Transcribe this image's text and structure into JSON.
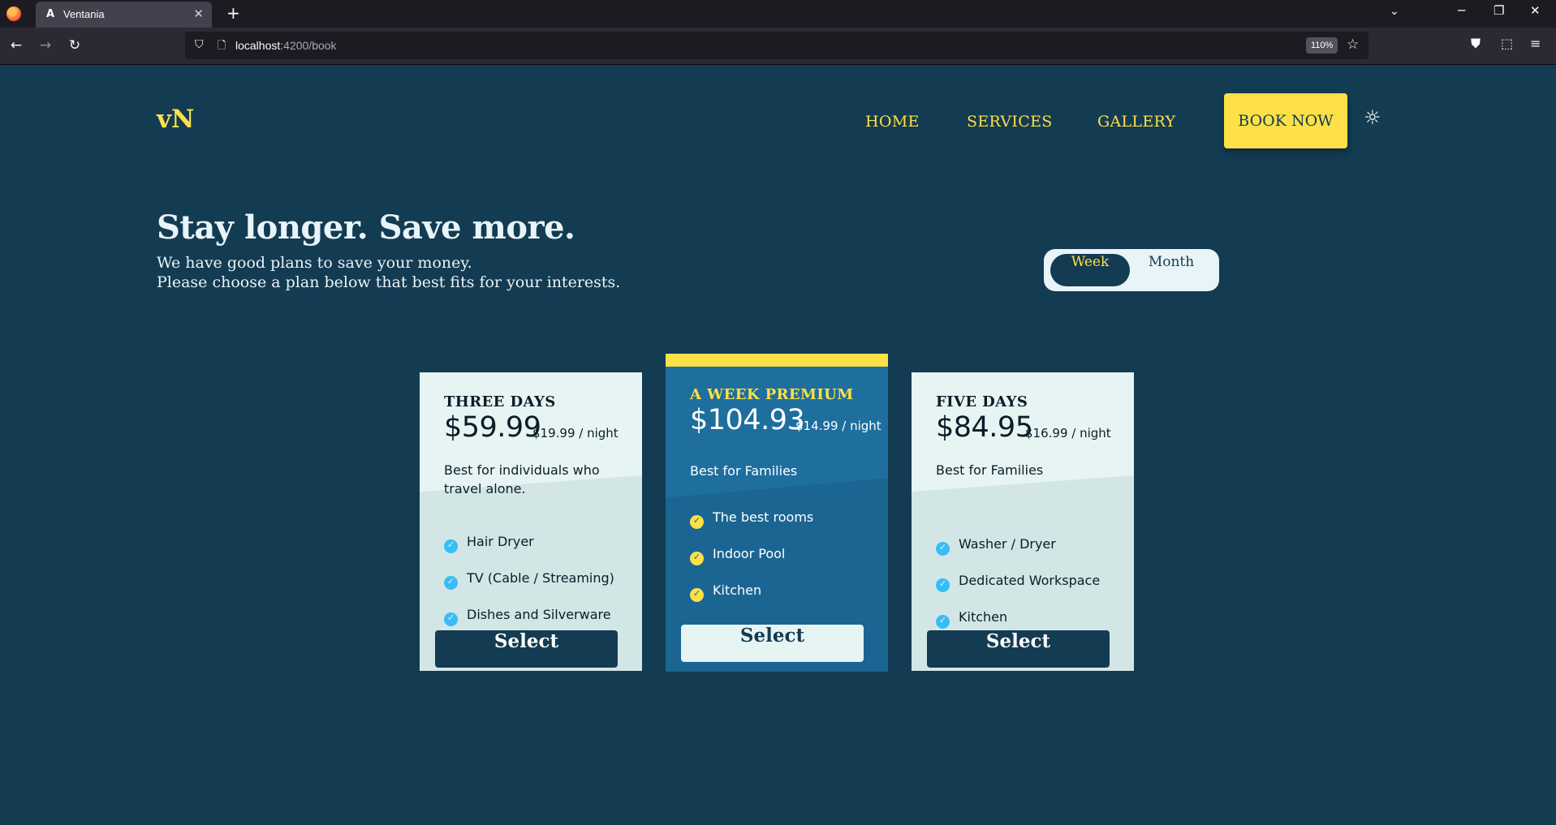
{
  "browser": {
    "tab_title": "Ventania",
    "tab_favicon": "A",
    "url_host": "localhost",
    "url_rest": ":4200/book",
    "zoom": "110%",
    "icons": {
      "back": "←",
      "forward": "→",
      "reload": "↻",
      "shield": "⛉",
      "page": "🗋",
      "star": "☆",
      "pocket": "⛊",
      "extensions": "⬚",
      "menu": "≡",
      "close_tab": "✕",
      "new_tab": "+",
      "list_tabs": "⌄",
      "minimize": "─",
      "restore": "❐",
      "close_window": "✕"
    }
  },
  "site": {
    "logo": "vN",
    "nav": [
      "HOME",
      "SERVICES",
      "GALLERY"
    ],
    "book_now": "BOOK NOW",
    "theme_icon": "☼"
  },
  "hero": {
    "title": "Stay longer. Save more.",
    "line1": "We have good plans to save your money.",
    "line2": "Please choose a plan below that best fits for your interests."
  },
  "toggle": {
    "options": [
      "Week",
      "Month"
    ],
    "selected": "Week"
  },
  "plans": [
    {
      "name": "THREE DAYS",
      "price": "$59.99",
      "nightly": "$19.99 / night",
      "description": "Best for individuals who travel alone.",
      "features": [
        "Hair Dryer",
        "TV (Cable / Streaming)",
        "Dishes and Silverware"
      ],
      "button": "Select",
      "featured": false
    },
    {
      "name": "A WEEK PREMIUM",
      "price": "$104.93",
      "nightly": "$14.99 / night",
      "description": "Best for Families",
      "features": [
        "The best rooms",
        "Indoor Pool",
        "Kitchen"
      ],
      "button": "Select",
      "featured": true
    },
    {
      "name": "FIVE DAYS",
      "price": "$84.95",
      "nightly": "$16.99 / night",
      "description": "Best for Families",
      "features": [
        "Washer / Dryer",
        "Dedicated Workspace",
        "Kitchen"
      ],
      "button": "Select",
      "featured": false
    }
  ],
  "check_icon": "✓",
  "colors": {
    "page_bg": "#133b52",
    "accent_yellow": "#fde047",
    "card_light": "#e6f4f3",
    "card_featured": "#1b6592",
    "check_blue": "#38bdf8"
  }
}
